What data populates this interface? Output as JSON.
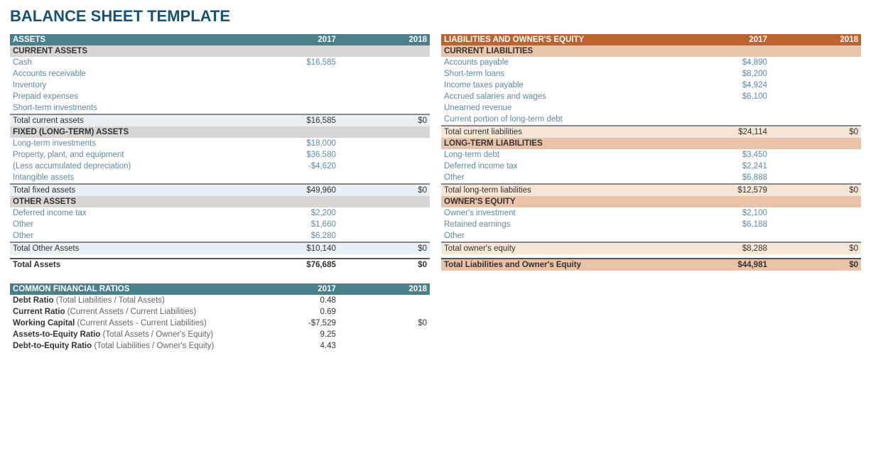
{
  "title": "BALANCE SHEET TEMPLATE",
  "assets": {
    "header": {
      "label": "ASSETS",
      "col2017": "2017",
      "col2018": "2018"
    },
    "current_assets": {
      "section_label": "CURRENT ASSETS",
      "rows": [
        {
          "label": "Cash",
          "val2017": "$16,585",
          "val2018": ""
        },
        {
          "label": "Accounts receivable",
          "val2017": "",
          "val2018": ""
        },
        {
          "label": "Inventory",
          "val2017": "",
          "val2018": ""
        },
        {
          "label": "Prepaid expenses",
          "val2017": "",
          "val2018": ""
        },
        {
          "label": "Short-term investments",
          "val2017": "",
          "val2018": ""
        }
      ],
      "total": {
        "label": "Total current assets",
        "val2017": "$16,585",
        "val2018": "$0"
      }
    },
    "fixed_assets": {
      "section_label": "FIXED (LONG-TERM) ASSETS",
      "rows": [
        {
          "label": "Long-term investments",
          "val2017": "$18,000",
          "val2018": ""
        },
        {
          "label": "Property, plant, and equipment",
          "val2017": "$36,580",
          "val2018": ""
        },
        {
          "label": "(Less accumulated depreciation)",
          "val2017": "-$4,620",
          "val2018": ""
        },
        {
          "label": "Intangible assets",
          "val2017": "",
          "val2018": ""
        }
      ],
      "total": {
        "label": "Total fixed assets",
        "val2017": "$49,960",
        "val2018": "$0"
      }
    },
    "other_assets": {
      "section_label": "OTHER ASSETS",
      "rows": [
        {
          "label": "Deferred income tax",
          "val2017": "$2,200",
          "val2018": ""
        },
        {
          "label": "Other",
          "val2017": "$1,660",
          "val2018": ""
        },
        {
          "label": "Other",
          "val2017": "$6,280",
          "val2018": ""
        }
      ],
      "total": {
        "label": "Total Other Assets",
        "val2017": "$10,140",
        "val2018": "$0"
      }
    },
    "grand_total": {
      "label": "Total Assets",
      "val2017": "$76,685",
      "val2018": "$0"
    }
  },
  "liabilities": {
    "header": {
      "label": "LIABILITIES AND OWNER'S EQUITY",
      "col2017": "2017",
      "col2018": "2018"
    },
    "current_liabilities": {
      "section_label": "CURRENT LIABILITIES",
      "rows": [
        {
          "label": "Accounts payable",
          "val2017": "$4,890",
          "val2018": ""
        },
        {
          "label": "Short-term loans",
          "val2017": "$8,200",
          "val2018": ""
        },
        {
          "label": "Income taxes payable",
          "val2017": "$4,924",
          "val2018": ""
        },
        {
          "label": "Accrued salaries and wages",
          "val2017": "$6,100",
          "val2018": ""
        },
        {
          "label": "Unearned revenue",
          "val2017": "",
          "val2018": ""
        },
        {
          "label": "Current portion of long-term debt",
          "val2017": "",
          "val2018": ""
        }
      ],
      "total": {
        "label": "Total current liabilities",
        "val2017": "$24,114",
        "val2018": "$0"
      }
    },
    "long_term_liabilities": {
      "section_label": "LONG-TERM LIABILITIES",
      "rows": [
        {
          "label": "Long-term debt",
          "val2017": "$3,450",
          "val2018": ""
        },
        {
          "label": "Deferred income tax",
          "val2017": "$2,241",
          "val2018": ""
        },
        {
          "label": "Other",
          "val2017": "$6,888",
          "val2018": ""
        }
      ],
      "total": {
        "label": "Total long-term liabilities",
        "val2017": "$12,579",
        "val2018": "$0"
      }
    },
    "owners_equity": {
      "section_label": "OWNER'S EQUITY",
      "rows": [
        {
          "label": "Owner's investment",
          "val2017": "$2,100",
          "val2018": ""
        },
        {
          "label": "Retained earnings",
          "val2017": "$6,188",
          "val2018": ""
        },
        {
          "label": "Other",
          "val2017": "",
          "val2018": ""
        }
      ],
      "total": {
        "label": "Total owner's equity",
        "val2017": "$8,288",
        "val2018": "$0"
      }
    },
    "grand_total": {
      "label": "Total Liabilities and Owner's Equity",
      "val2017": "$44,981",
      "val2018": "$0"
    }
  },
  "ratios": {
    "header": {
      "label": "COMMON FINANCIAL RATIOS",
      "col2017": "2017",
      "col2018": "2018"
    },
    "rows": [
      {
        "label": "Debt Ratio",
        "sublabel": " (Total Liabilities / Total Assets)",
        "val2017": "0.48",
        "val2018": ""
      },
      {
        "label": "Current Ratio",
        "sublabel": " (Current Assets / Current Liabilities)",
        "val2017": "0.69",
        "val2018": ""
      },
      {
        "label": "Working Capital",
        "sublabel": " (Current Assets - Current Liabilities)",
        "val2017": "-$7,529",
        "val2018": "$0"
      },
      {
        "label": "Assets-to-Equity Ratio",
        "sublabel": " (Total Assets / Owner's Equity)",
        "val2017": "9.25",
        "val2018": ""
      },
      {
        "label": "Debt-to-Equity Ratio",
        "sublabel": " (Total Liabilities / Owner's Equity)",
        "val2017": "4.43",
        "val2018": ""
      }
    ]
  }
}
